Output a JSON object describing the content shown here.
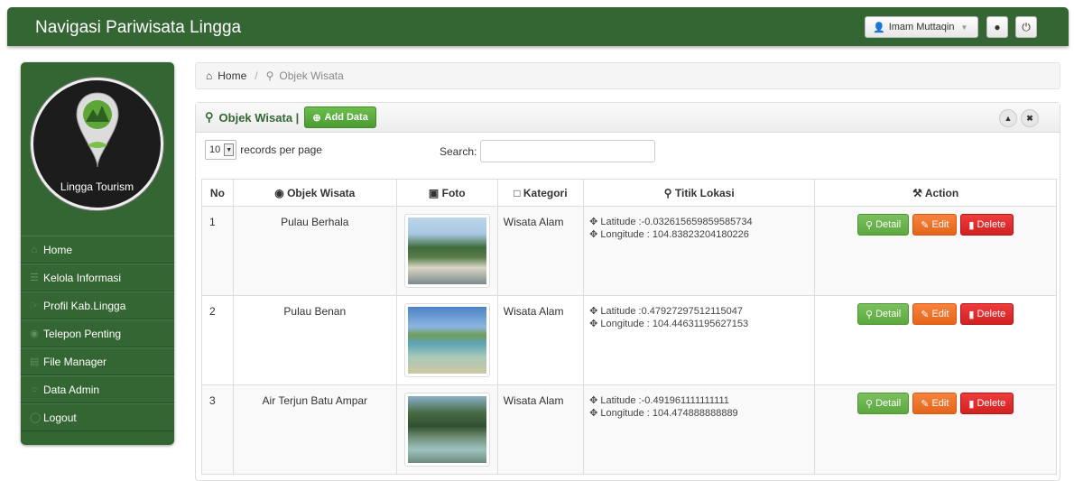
{
  "navbar": {
    "brand": "Navigasi Pariwisata Lingga",
    "user_label": "Imam Muttaqin"
  },
  "sidebar": {
    "logo_text": "Lingga Tourism",
    "items": [
      {
        "label": "Home"
      },
      {
        "label": "Kelola Informasi"
      },
      {
        "label": "Profil Kab.Lingga"
      },
      {
        "label": "Telepon Penting"
      },
      {
        "label": "File Manager"
      },
      {
        "label": "Data Admin"
      },
      {
        "label": "Logout"
      }
    ]
  },
  "breadcrumb": {
    "home": "Home",
    "current": "Objek Wisata"
  },
  "panel": {
    "title": "Objek Wisata |",
    "add_label": "Add Data"
  },
  "controls": {
    "per_page_value": "10",
    "per_page_label": "records per page",
    "search_label": "Search:",
    "search_value": ""
  },
  "table": {
    "headers": {
      "no": "No",
      "name": "Objek Wisata",
      "foto": "Foto",
      "kategori": "Kategori",
      "lokasi": "Titik Lokasi",
      "action": "Action"
    },
    "rows": [
      {
        "no": "1",
        "name": "Pulau Berhala",
        "kategori": "Wisata Alam",
        "lat": "Latitude :-0.032615659859585734",
        "lon": "Longitude : 104.83823204180226"
      },
      {
        "no": "2",
        "name": "Pulau Benan",
        "kategori": "Wisata Alam",
        "lat": "Latitude :0.47927297512115047",
        "lon": "Longitude : 104.44631195627153"
      },
      {
        "no": "3",
        "name": "Air Terjun Batu Ampar",
        "kategori": "Wisata Alam",
        "lat": "Latitude :-0.491961111111111",
        "lon": "Longitude : 104.474888888889"
      }
    ],
    "actions": {
      "detail": "Detail",
      "edit": "Edit",
      "delete": "Delete"
    }
  },
  "colors": {
    "brand_green": "#336633",
    "detail": "#5ca83f",
    "edit": "#e4651a",
    "delete": "#d22121"
  }
}
